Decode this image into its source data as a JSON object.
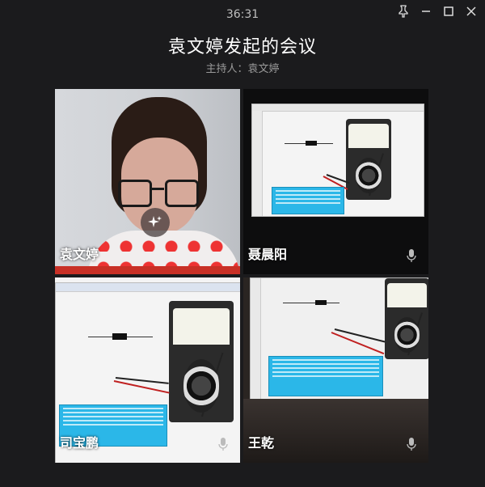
{
  "timer": "36:31",
  "meeting": {
    "title": "袁文婷发起的会议",
    "host_label": "主持人：袁文婷"
  },
  "window_controls": {
    "pin_icon": "pin-icon",
    "minimize_icon": "minimize-icon",
    "maximize_icon": "maximize-icon",
    "close_icon": "close-icon"
  },
  "participants": [
    {
      "name": "袁文婷",
      "stream": "camera",
      "mic": false
    },
    {
      "name": "聂晨阳",
      "stream": "screen-share",
      "mic": true
    },
    {
      "name": "司宝鹏",
      "stream": "screen-share",
      "mic": true
    },
    {
      "name": "王乾",
      "stream": "screen-share",
      "mic": true
    }
  ],
  "colors": {
    "background": "#1b1b1d",
    "info_box": "#2bb7e8",
    "shirt_dot": "#e33333",
    "probe_red": "#c02020"
  }
}
